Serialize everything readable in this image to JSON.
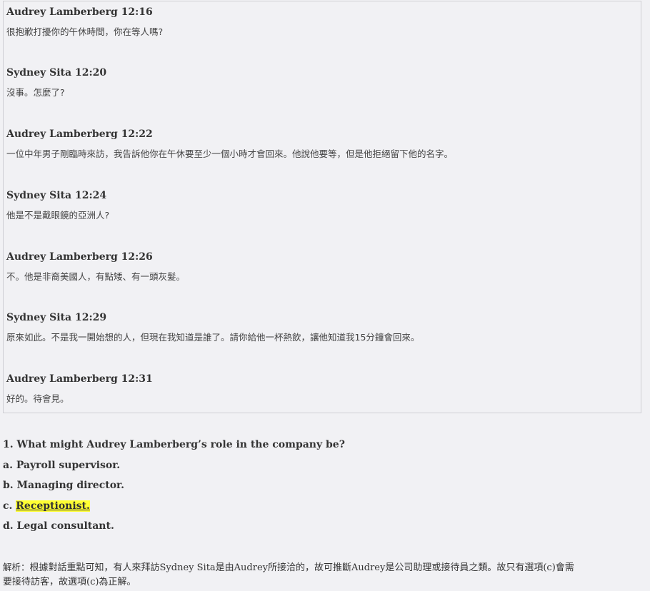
{
  "messages": [
    {
      "header": "Audrey Lamberberg 12:16",
      "text": "很抱歉打擾你的午休時間，你在等人嗎?"
    },
    {
      "header": "Sydney Sita 12:20",
      "text": "沒事。怎麼了?"
    },
    {
      "header": "Audrey Lamberberg 12:22",
      "text": "一位中年男子剛臨時來訪，我告訴他你在午休要至少一個小時才會回來。他說他要等，但是他拒絕留下他的名字。"
    },
    {
      "header": "Sydney Sita 12:24",
      "text": "他是不是戴眼鏡的亞洲人?"
    },
    {
      "header": "Audrey Lamberberg 12:26",
      "text": "不。他是非裔美國人，有點矮、有一頭灰髮。"
    },
    {
      "header": "Sydney Sita 12:29",
      "text": "原來如此。不是我一開始想的人，但現在我知道是誰了。請你給他一杯熱飲，讓他知道我15分鐘會回來。"
    },
    {
      "header": "Audrey Lamberberg 12:31",
      "text": "好的。待會見。"
    }
  ],
  "question": "1. What might Audrey Lamberberg’s role in the company be?",
  "options": [
    {
      "letter": "a.",
      "text": "Payroll supervisor."
    },
    {
      "letter": "b.",
      "text": "Managing director."
    },
    {
      "letter": "c.",
      "text": "Receptionist."
    },
    {
      "letter": "d.",
      "text": "Legal consultant."
    }
  ],
  "highlight_color": "#ffff33",
  "analysis_label": "解析：",
  "analysis_line1": "根據對話重點可知，有人來拜訪Sydney Sita是由Audrey所接洽的，故可推斷Audrey是公司助理或接待員之類。故只有選項(c)會需",
  "analysis_line2": "要接待訪客，故選項(c)為正解。"
}
